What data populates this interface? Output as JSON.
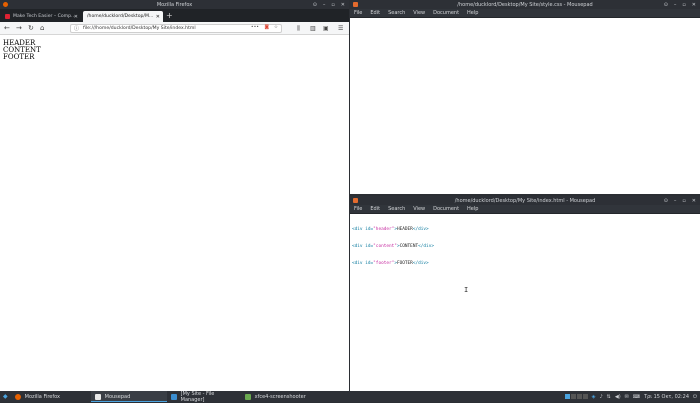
{
  "firefox": {
    "window_title": "Mozilla Firefox",
    "tabs": [
      {
        "label": "Make Tech Easier – Comp...",
        "active": false
      },
      {
        "label": "/home/ducklord/Desktop/M...",
        "active": true
      }
    ],
    "new_tab": "+",
    "url": "file:///home/ducklord/Desktop/My Site/index.html",
    "page_lines": [
      "HEADER",
      "CONTENT",
      "FOOTER"
    ]
  },
  "mousepad_top": {
    "window_title": "/home/ducklord/Desktop/My Site/style.css - Mousepad",
    "menu": [
      "File",
      "Edit",
      "Search",
      "View",
      "Document",
      "Help"
    ]
  },
  "mousepad_bottom": {
    "window_title": "/home/ducklord/Desktop/My Site/index.html - Mousepad",
    "menu": [
      "File",
      "Edit",
      "Search",
      "View",
      "Document",
      "Help"
    ],
    "code_lines": [
      {
        "open": "<div",
        "attr": " id=",
        "val": "\"header\"",
        "close": ">",
        "text": "HEADER",
        "end": "</div>"
      },
      {
        "open": "<div",
        "attr": " id=",
        "val": "\"content\"",
        "close": ">",
        "text": "CONTENT",
        "end": "</div>"
      },
      {
        "open": "<div",
        "attr": " id=",
        "val": "\"footer\"",
        "close": ">",
        "text": "FOOTER",
        "end": "</div>"
      }
    ]
  },
  "taskbar": {
    "items": [
      {
        "label": "Mozilla Firefox",
        "icon": "firefox-icon",
        "active": false
      },
      {
        "label": "Mousepad",
        "icon": "mousepad-icon",
        "active": true
      },
      {
        "label": "[My Site - File Manager]",
        "icon": "folder-icon",
        "active": false
      },
      {
        "label": "xfce4-screenshooter",
        "icon": "screenshot-icon",
        "active": false
      }
    ],
    "clock": "Τρι 15 Οκτ, 02:24"
  },
  "colors": {
    "firefox_accent": "#e66000",
    "taskbar_active": "#4aa3df",
    "tag_color": "#0b7a9e",
    "string_color": "#c62aa0"
  }
}
